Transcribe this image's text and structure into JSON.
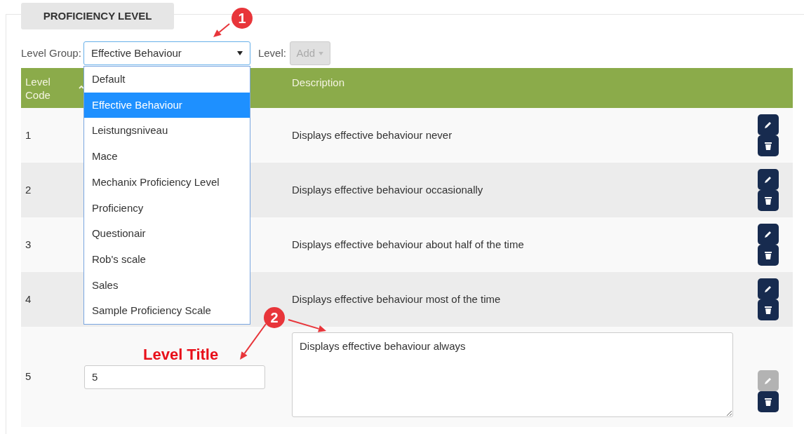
{
  "section_tab": "PROFICIENCY LEVEL",
  "level_group": {
    "label": "Level Group:",
    "value": "Effective Behaviour",
    "expanded": true
  },
  "level": {
    "label": "Level:",
    "button": "Add",
    "disabled": true
  },
  "dropdown_options": [
    {
      "label": "Default",
      "selected": false
    },
    {
      "label": "Effective Behaviour",
      "selected": true
    },
    {
      "label": "Leistungsniveau",
      "selected": false
    },
    {
      "label": "Mace",
      "selected": false
    },
    {
      "label": "Mechanix Proficiency Level",
      "selected": false
    },
    {
      "label": "Proficiency",
      "selected": false
    },
    {
      "label": "Questionair",
      "selected": false
    },
    {
      "label": "Rob's scale",
      "selected": false
    },
    {
      "label": "Sales",
      "selected": false
    },
    {
      "label": "Sample Proficiency Scale",
      "selected": false
    }
  ],
  "table": {
    "columns": [
      {
        "label": "Level Code"
      },
      {
        "label": "Description"
      }
    ],
    "rows": [
      {
        "code": "1",
        "description": "Displays effective behaviour never",
        "editing": false
      },
      {
        "code": "2",
        "description": "Displays effective behaviour occasionally",
        "editing": false
      },
      {
        "code": "3",
        "description": "Displays effective behaviour about half of the time",
        "editing": false
      },
      {
        "code": "4",
        "description": "Displays effective behaviour most of the time",
        "editing": false
      },
      {
        "code": "5",
        "title": "5",
        "description": "Displays effective behaviour always",
        "editing": true
      }
    ]
  },
  "annotations": [
    {
      "number": "1"
    },
    {
      "number": "2",
      "label": "Level Title"
    }
  ]
}
